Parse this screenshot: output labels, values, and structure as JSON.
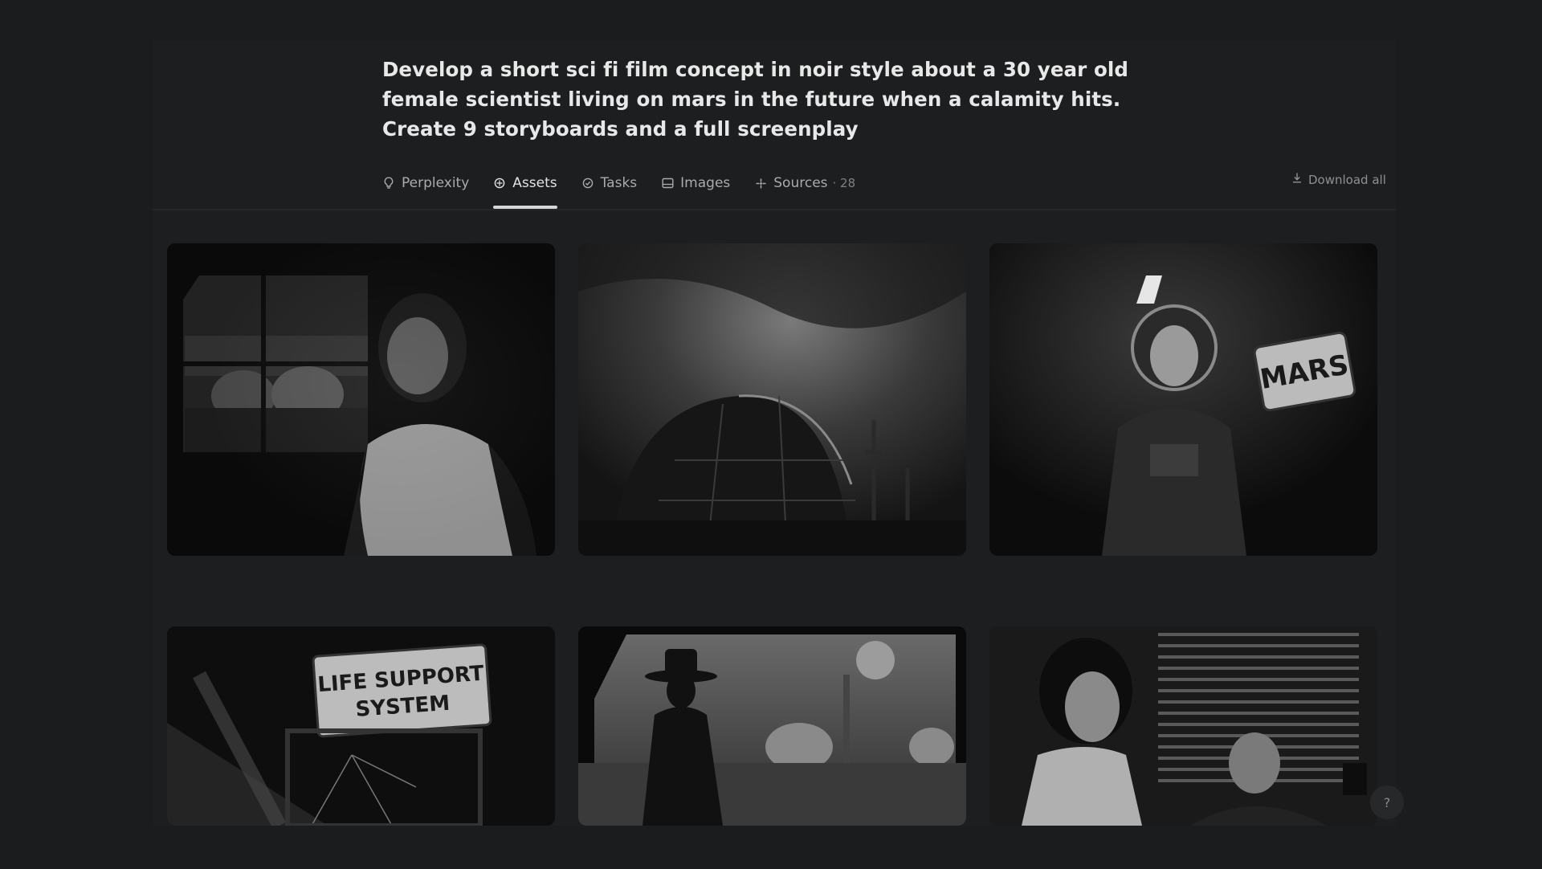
{
  "query": {
    "lines": [
      "Develop a short sci fi film concept in noir style about a 30 year old",
      "female scientist living on mars in the future when a calamity hits.",
      "Create 9 storyboards and a full screenplay"
    ]
  },
  "tabs": [
    {
      "label": "Perplexity",
      "icon": "lightbulb-icon"
    },
    {
      "label": "Assets",
      "icon": "assets-icon",
      "active": true
    },
    {
      "label": "Tasks",
      "icon": "check-circle-icon"
    },
    {
      "label": "Images",
      "icon": "image-icon"
    },
    {
      "label": "Sources",
      "icon": "sources-icon",
      "count": "· 28"
    }
  ],
  "download_all": {
    "label": "Download all",
    "icon": "download-icon"
  },
  "images": [
    {
      "name": "scientist-window-habitat"
    },
    {
      "name": "dome-storm"
    },
    {
      "name": "astronaut-mars-sign",
      "sign_text": "MARS"
    },
    {
      "name": "life-support-system-sign",
      "sign_text_1": "LIFE SUPPORT",
      "sign_text_2": "SYSTEM"
    },
    {
      "name": "silhouette-fedora-colony"
    },
    {
      "name": "woman-man-interrogation"
    }
  ],
  "help_button": {
    "label": "?"
  }
}
